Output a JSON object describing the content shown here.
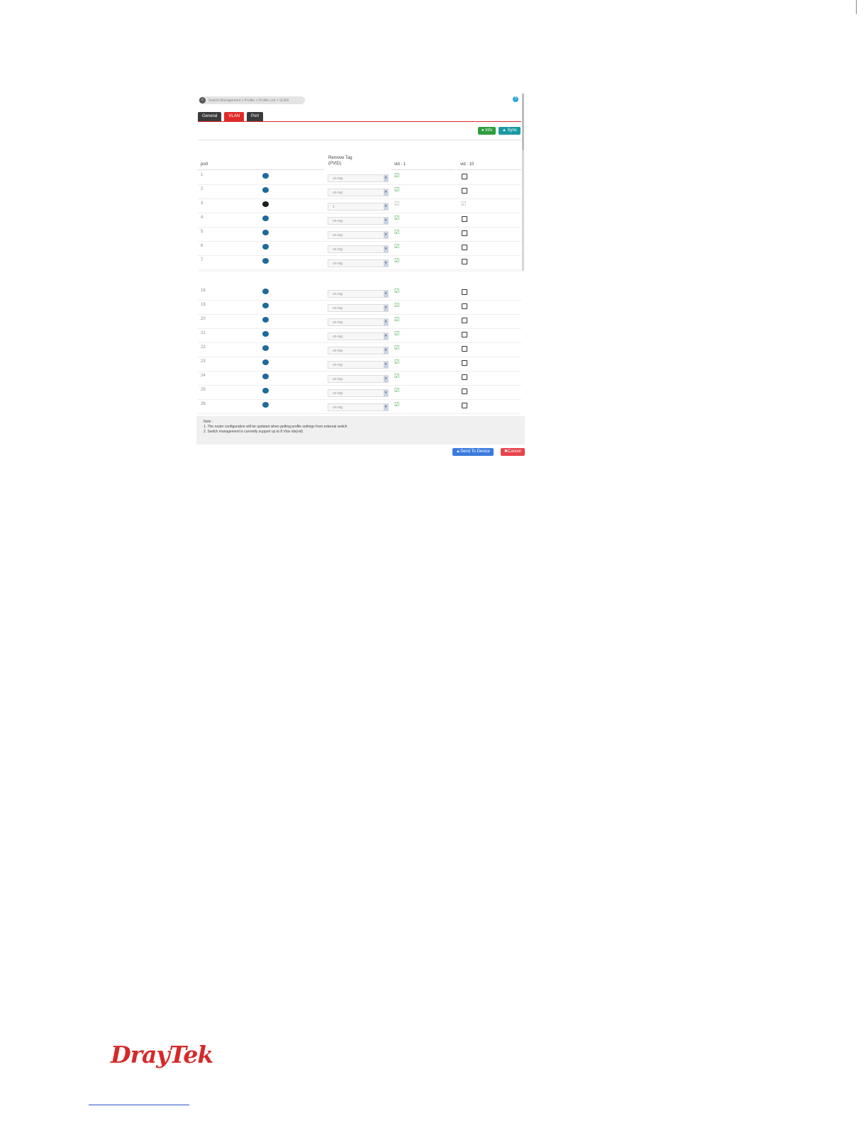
{
  "breadcrumb": "Switch Management > Profile > Profile List > VLAN",
  "tabs": [
    "General",
    "VLAN",
    "Port"
  ],
  "buttons": {
    "info": "Info",
    "sync": "Sync",
    "send": "Send To Device",
    "cancel": "Cancel"
  },
  "table": {
    "headers": {
      "port": "port",
      "remove_tag": "Remove Tag",
      "pvid": "(PVID)",
      "vid1": "vid : 1",
      "vid10": "vid : 10"
    },
    "rows": [
      {
        "port": "1",
        "pvid": "un-tag",
        "status": "on",
        "vid1": "checked",
        "vid10": "unchecked"
      },
      {
        "port": "2",
        "pvid": "un-tag",
        "status": "on",
        "vid1": "checked",
        "vid10": "unchecked"
      },
      {
        "port": "3",
        "pvid": "1",
        "status": "off",
        "vid1": "checked-disabled",
        "vid10": "checked-disabled"
      },
      {
        "port": "4",
        "pvid": "un-tag",
        "status": "on",
        "vid1": "checked",
        "vid10": "unchecked"
      },
      {
        "port": "5",
        "pvid": "un-tag",
        "status": "on",
        "vid1": "checked",
        "vid10": "unchecked"
      },
      {
        "port": "6",
        "pvid": "un-tag",
        "status": "on",
        "vid1": "checked",
        "vid10": "unchecked"
      },
      {
        "port": "7",
        "pvid": "un-tag",
        "status": "on",
        "vid1": "checked",
        "vid10": "unchecked"
      },
      {
        "port": "18",
        "pvid": "un-tag",
        "status": "on",
        "vid1": "checked",
        "vid10": "unchecked"
      },
      {
        "port": "19",
        "pvid": "un-tag",
        "status": "on",
        "vid1": "checked",
        "vid10": "unchecked"
      },
      {
        "port": "20",
        "pvid": "un-tag",
        "status": "on",
        "vid1": "checked",
        "vid10": "unchecked"
      },
      {
        "port": "21",
        "pvid": "un-tag",
        "status": "on",
        "vid1": "checked",
        "vid10": "unchecked"
      },
      {
        "port": "22",
        "pvid": "un-tag",
        "status": "on",
        "vid1": "checked",
        "vid10": "unchecked"
      },
      {
        "port": "23",
        "pvid": "un-tag",
        "status": "on",
        "vid1": "checked",
        "vid10": "unchecked"
      },
      {
        "port": "24",
        "pvid": "un-tag",
        "status": "on",
        "vid1": "checked",
        "vid10": "unchecked"
      },
      {
        "port": "25",
        "pvid": "un-tag",
        "status": "on",
        "vid1": "checked",
        "vid10": "unchecked"
      },
      {
        "port": "26",
        "pvid": "un-tag",
        "status": "on",
        "vid1": "checked",
        "vid10": "unchecked"
      }
    ]
  },
  "note": {
    "title": "Note :",
    "line1": "1. The router configuration will be updated when getting profile settings from external switch",
    "line2": "2. Switch management is currently support up to 8 Vlan ids(vid)"
  },
  "brand": {
    "logo": "DrayTek",
    "color": "#d52a2a"
  }
}
